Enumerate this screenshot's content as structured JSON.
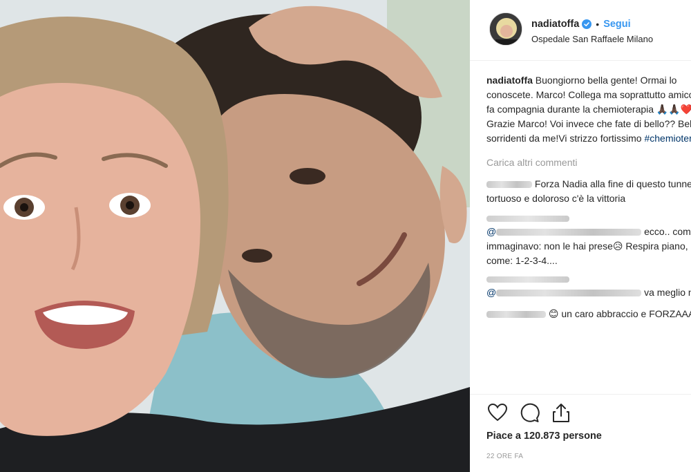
{
  "post": {
    "username": "nadiatoffa",
    "follow_label": "Segui",
    "separator": "•",
    "location": "Ospedale San Raffaele Milano",
    "verified_icon": "verified-badge-icon",
    "accent_color": "#3897f0"
  },
  "caption": {
    "username": "nadiatoffa",
    "text": " Buongiorno bella gente! Ormai lo conoscete. Marco! Collega ma soprattutto amico!mi fa compagnia durante la chemioterapia 🙏🏿🙏🏿❤️Grazie Marco! Voi invece che fate di bello?? Belli sorridenti da me!Vi strizzo fortissimo ",
    "hashtag": "#chemioterapia"
  },
  "load_more_label": "Carica altri commenti",
  "comments": [
    {
      "text": " Forza Nadia alla fine di questo tunnel tortuoso e doloroso c'è la vittoria"
    },
    {
      "mention": "@",
      "text": " ecco.. come immaginavo: non le hai prese😥 Respira piano, conta come: 1-2-3-4...."
    },
    {
      "mention": "@",
      "text": " va meglio nini?"
    },
    {
      "text": " 😊 un caro abbraccio e FORZAAAA!!"
    }
  ],
  "actions": {
    "like_icon": "heart-icon",
    "comment_icon": "comment-icon",
    "share_icon": "share-icon"
  },
  "likes_text": "Piace a 120.873 persone",
  "time_text": "22 ORE FA"
}
